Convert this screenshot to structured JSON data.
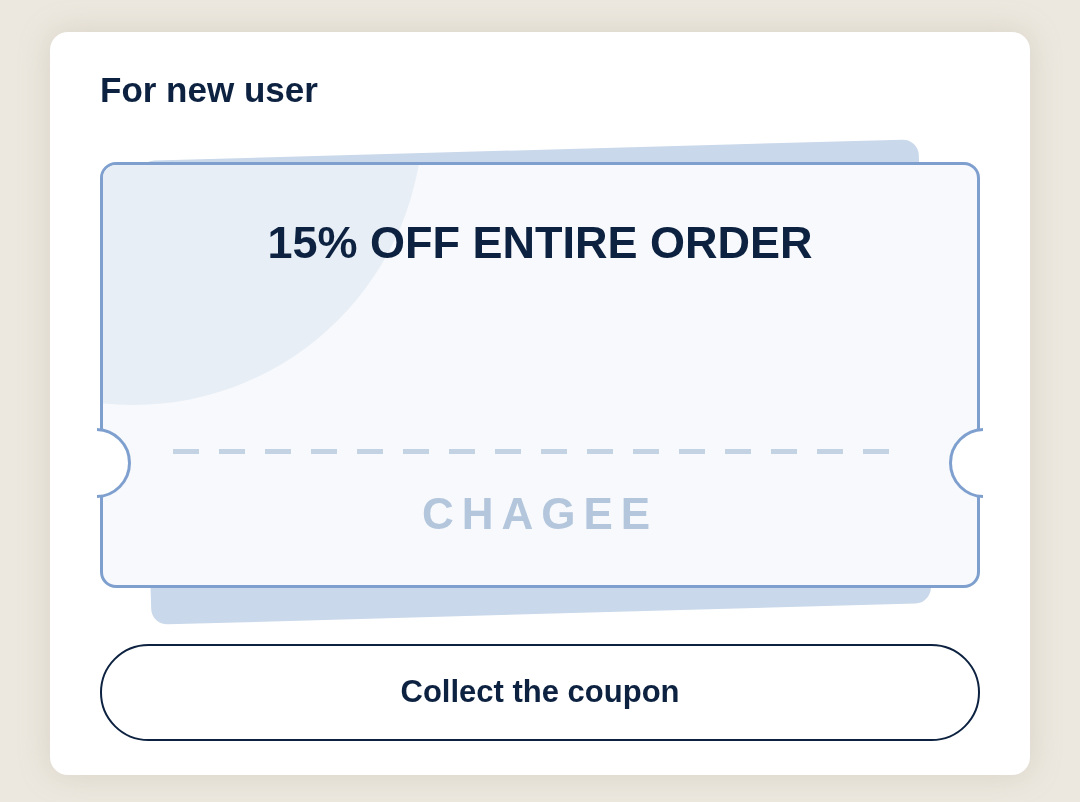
{
  "card": {
    "title": "For new user"
  },
  "coupon": {
    "headline": "15% OFF ENTIRE ORDER",
    "brand": "CHAGEE"
  },
  "button": {
    "label": "Collect the coupon"
  }
}
